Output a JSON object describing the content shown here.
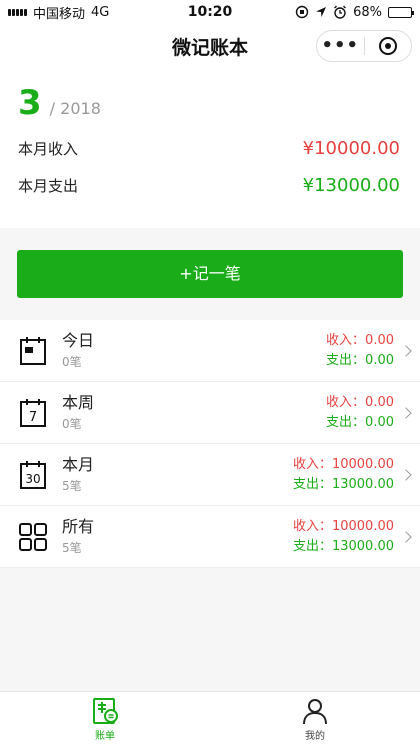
{
  "status": {
    "carrier": "中国移动",
    "network": "4G",
    "time": "10:20",
    "battery": "68%",
    "battery_level": 0.68
  },
  "nav": {
    "title": "微记账本",
    "more_icon": "more-dots-icon",
    "target_icon": "target-icon"
  },
  "summary": {
    "month": "3",
    "year_text": "/ 2018",
    "income_label": "本月收入",
    "income_value": "¥10000.00",
    "expense_label": "本月支出",
    "expense_value": "¥13000.00"
  },
  "record_button": "+记一笔",
  "list": [
    {
      "title": "今日",
      "count": "0笔",
      "income": "收入：0.00",
      "expense": "支出：0.00",
      "icon": "calendar-today-icon"
    },
    {
      "title": "本周",
      "count": "0笔",
      "income": "收入：0.00",
      "expense": "支出：0.00",
      "icon": "calendar-week-icon",
      "icon_text": "7"
    },
    {
      "title": "本月",
      "count": "5笔",
      "income": "收入：10000.00",
      "expense": "支出：13000.00",
      "icon": "calendar-month-icon",
      "icon_text": "30"
    },
    {
      "title": "所有",
      "count": "5笔",
      "income": "收入：10000.00",
      "expense": "支出：13000.00",
      "icon": "grid-icon"
    }
  ],
  "tabbar": {
    "tabs": [
      {
        "label": "账单",
        "icon": "bill-icon",
        "active": true
      },
      {
        "label": "我的",
        "icon": "user-icon",
        "active": false
      }
    ]
  },
  "colors": {
    "accent": "#1aad19",
    "income": "#e64340",
    "muted": "#999999"
  }
}
